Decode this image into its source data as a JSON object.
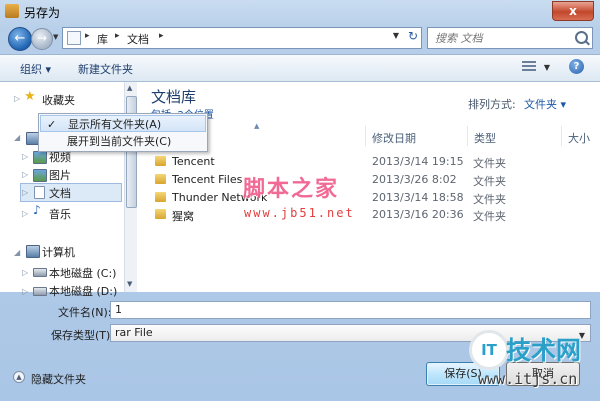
{
  "window": {
    "title": "另存为",
    "close_glyph": "x"
  },
  "nav_buttons": {
    "back": "←",
    "forward": "→",
    "history": "▼"
  },
  "address": {
    "segments": [
      "库",
      "文档"
    ],
    "separator": "▸",
    "refresh": "↻"
  },
  "search": {
    "placeholder": "搜索 文档"
  },
  "toolbar": {
    "organize": "组织 ▾",
    "new_folder": "新建文件夹",
    "help": "?"
  },
  "nav": {
    "favorites": "收藏夹",
    "videos": "视频",
    "pictures": "图片",
    "documents": "文档",
    "music": "音乐",
    "computer": "计算机",
    "local_disk_c": "本地磁盘 (C:)",
    "local_disk_d": "本地磁盘 (D:)"
  },
  "context_menu": {
    "items": [
      {
        "label": "显示所有文件夹(A)",
        "checked": true
      },
      {
        "label": "展开到当前文件夹(C)",
        "checked": false
      }
    ],
    "check_glyph": "✓"
  },
  "library": {
    "title": "文档库",
    "subtitle": "包括: 2个位置",
    "arrange_label": "排列方式:",
    "arrange_value": "文件夹 ▾"
  },
  "columns": {
    "name": "名称",
    "date": "修改日期",
    "type": "类型",
    "size": "大小"
  },
  "files": [
    {
      "name": "Tencent",
      "date": "2013/3/14 19:15",
      "type": "文件夹"
    },
    {
      "name": "Tencent Files",
      "date": "2013/3/26 8:02",
      "type": "文件夹"
    },
    {
      "name": "Thunder Network",
      "date": "2013/3/14 18:58",
      "type": "文件夹"
    },
    {
      "name": "猩窝",
      "date": "2013/3/16 20:36",
      "type": "文件夹"
    }
  ],
  "form": {
    "filename_label": "文件名(N):",
    "filename_value": "1",
    "savetype_label": "保存类型(T):",
    "savetype_value": "rar File"
  },
  "footer": {
    "hide_folders": "隐藏文件夹",
    "save": "保存(S)",
    "cancel": "取消"
  },
  "watermarks": {
    "jb51_text": "脚本之家",
    "jb51_url": "www.jb51.net",
    "itjs_logo": "IT",
    "itjs_text": "技术网",
    "itjs_url": "www.itjs.cn"
  },
  "colors": {
    "accent": "#1c57a7",
    "title_blue": "#1e3f6e",
    "close_red": "#c3472c"
  }
}
